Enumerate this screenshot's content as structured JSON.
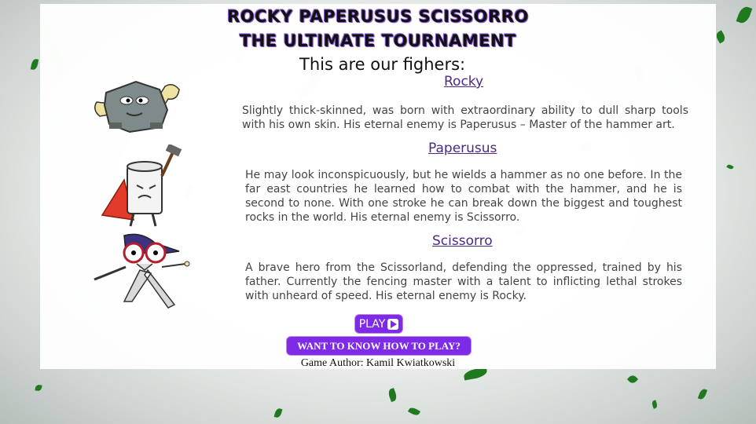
{
  "header": {
    "title_line1": "ROCKY PAPERUSUS SCISSORRO",
    "title_line2": "THE ULTIMATE TOURNAMENT",
    "subtitle": "This are our fighers:"
  },
  "fighters": [
    {
      "name": "Rocky",
      "description": "Slightly thick-skinned, was born with extraordinary ability to dull sharp tools with his own skin. His eternal enemy is Paperusus – Master of the hammer art.",
      "icon": "rock-fighter-icon"
    },
    {
      "name": "Paperusus",
      "description": "He may look inconspicuously, but he wields a hammer as no one before. In the far east countries he learned how to combat with the hammer, and he is second to none. With one stroke he can break down the biggest and toughest rocks in the world. His eternal enemy is Scissorro.",
      "icon": "paper-fighter-icon"
    },
    {
      "name": "Scissorro",
      "description": "A brave hero from the Scissorland, defending the oppressed, trained by his father. Currently the fencing master with a talent to inflicting lethal strokes with unheard of speed. His eternal enemy is Rocky.",
      "icon": "scissors-fighter-icon"
    }
  ],
  "buttons": {
    "play_label": "PLAY",
    "howto_label": "WANT TO KNOW HOW TO PLAY?"
  },
  "footer": {
    "author": "Game Author: Kamil Kwiatkowski"
  },
  "colors": {
    "accent": "#7d2be6",
    "link": "#4b2a7f",
    "leaf_dark": "#1f7a1f",
    "leaf_light": "#9fd39f"
  }
}
